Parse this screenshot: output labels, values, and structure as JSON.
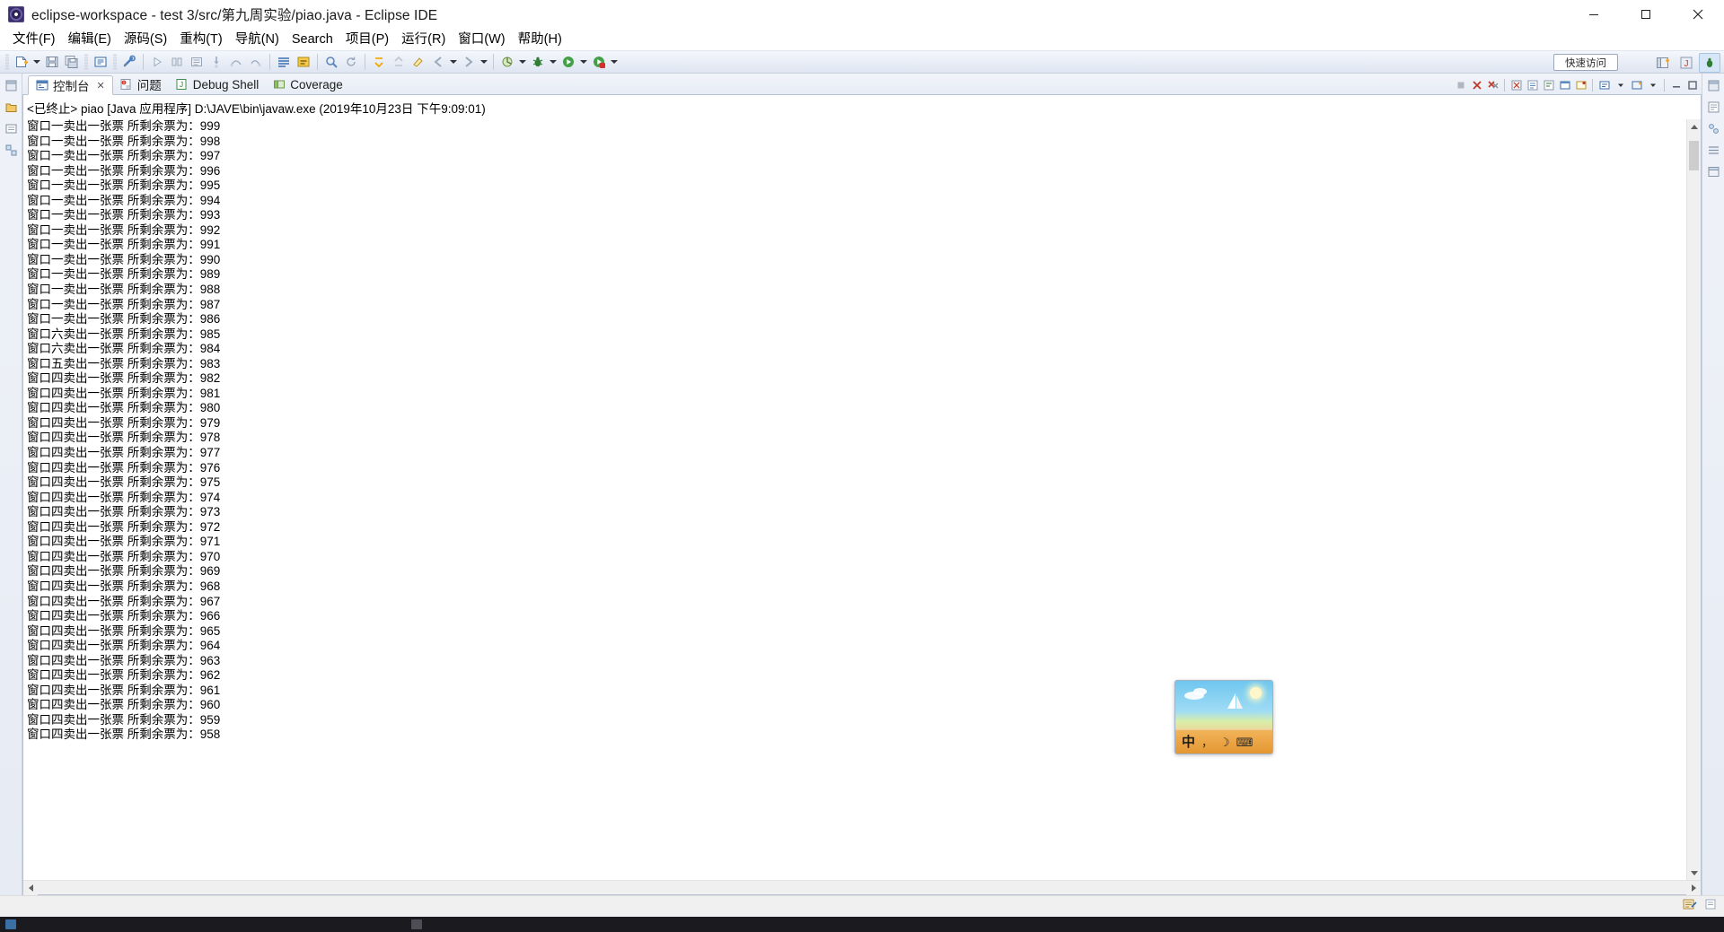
{
  "window": {
    "title": "eclipse-workspace - test 3/src/第九周实验/piao.java - Eclipse IDE",
    "icon": "eclipse-icon",
    "controls": {
      "minimize": "–",
      "maximize": "☐",
      "close": "✕"
    }
  },
  "menubar": {
    "items": [
      {
        "label": "文件(F)",
        "name": "menu-file"
      },
      {
        "label": "编辑(E)",
        "name": "menu-edit"
      },
      {
        "label": "源码(S)",
        "name": "menu-source"
      },
      {
        "label": "重构(T)",
        "name": "menu-refactor"
      },
      {
        "label": "导航(N)",
        "name": "menu-navigate"
      },
      {
        "label": "Search",
        "name": "menu-search"
      },
      {
        "label": "项目(P)",
        "name": "menu-project"
      },
      {
        "label": "运行(R)",
        "name": "menu-run"
      },
      {
        "label": "窗口(W)",
        "name": "menu-window"
      },
      {
        "label": "帮助(H)",
        "name": "menu-help"
      }
    ]
  },
  "toolbar": {
    "quick_access": "快速访问",
    "icons": [
      "new-wizard-icon",
      "save-icon",
      "save-all-icon",
      "print-icon",
      "build-icon",
      "run-last-tool-icon",
      "skip-breakpoints-icon",
      "toggle-breakpoint-icon",
      "step-into-icon",
      "step-over-icon",
      "step-return-icon",
      "open-type-icon",
      "search-icon",
      "history-icon",
      "next-annotation-icon",
      "previous-annotation-icon",
      "last-edit-icon",
      "back-icon",
      "forward-icon",
      "coverage-icon",
      "debug-icon",
      "run-icon",
      "external-tools-icon"
    ],
    "perspective_icons": [
      "open-perspective-icon",
      "java-perspective-icon",
      "debug-perspective-icon"
    ]
  },
  "view_tabs": {
    "items": [
      {
        "label": "控制台",
        "icon": "console-icon",
        "active": true,
        "closable": true
      },
      {
        "label": "问题",
        "icon": "problems-icon",
        "active": false,
        "closable": false
      },
      {
        "label": "Debug Shell",
        "icon": "debug-shell-icon",
        "active": false,
        "closable": false
      },
      {
        "label": "Coverage",
        "icon": "coverage-icon",
        "active": false,
        "closable": false
      }
    ],
    "toolbar_icons": [
      "terminate-icon",
      "remove-launch-icon",
      "remove-all-terminated-icon",
      "clear-console-icon",
      "scroll-lock-icon",
      "word-wrap-icon",
      "show-console-on-output-icon",
      "pin-console-icon",
      "display-selected-console-icon",
      "open-console-icon",
      "view-menu-icon",
      "minimize-icon",
      "maximize-icon"
    ]
  },
  "console": {
    "header": "<已终止> piao [Java 应用程序] D:\\JAVE\\bin\\javaw.exe  (2019年10月23日 下午9:09:01)",
    "lines": [
      "窗口一卖出一张票 所剩余票为：999",
      "窗口一卖出一张票 所剩余票为：998",
      "窗口一卖出一张票 所剩余票为：997",
      "窗口一卖出一张票 所剩余票为：996",
      "窗口一卖出一张票 所剩余票为：995",
      "窗口一卖出一张票 所剩余票为：994",
      "窗口一卖出一张票 所剩余票为：993",
      "窗口一卖出一张票 所剩余票为：992",
      "窗口一卖出一张票 所剩余票为：991",
      "窗口一卖出一张票 所剩余票为：990",
      "窗口一卖出一张票 所剩余票为：989",
      "窗口一卖出一张票 所剩余票为：988",
      "窗口一卖出一张票 所剩余票为：987",
      "窗口一卖出一张票 所剩余票为：986",
      "窗口六卖出一张票 所剩余票为：985",
      "窗口六卖出一张票 所剩余票为：984",
      "窗口五卖出一张票 所剩余票为：983",
      "窗口四卖出一张票 所剩余票为：982",
      "窗口四卖出一张票 所剩余票为：981",
      "窗口四卖出一张票 所剩余票为：980",
      "窗口四卖出一张票 所剩余票为：979",
      "窗口四卖出一张票 所剩余票为：978",
      "窗口四卖出一张票 所剩余票为：977",
      "窗口四卖出一张票 所剩余票为：976",
      "窗口四卖出一张票 所剩余票为：975",
      "窗口四卖出一张票 所剩余票为：974",
      "窗口四卖出一张票 所剩余票为：973",
      "窗口四卖出一张票 所剩余票为：972",
      "窗口四卖出一张票 所剩余票为：971",
      "窗口四卖出一张票 所剩余票为：970",
      "窗口四卖出一张票 所剩余票为：969",
      "窗口四卖出一张票 所剩余票为：968",
      "窗口四卖出一张票 所剩余票为：967",
      "窗口四卖出一张票 所剩余票为：966",
      "窗口四卖出一张票 所剩余票为：965",
      "窗口四卖出一张票 所剩余票为：964",
      "窗口四卖出一张票 所剩余票为：963",
      "窗口四卖出一张票 所剩余票为：962",
      "窗口四卖出一张票 所剩余票为：961",
      "窗口四卖出一张票 所剩余票为：960",
      "窗口四卖出一张票 所剩余票为：959",
      "窗口四卖出一张票 所剩余票为：958"
    ]
  },
  "floating_widget": {
    "name": "ime-language-bar",
    "items": [
      {
        "label": "中",
        "name": "ime-mode-chinese"
      },
      {
        "label": "，",
        "name": "ime-punctuation"
      },
      {
        "label": "☽",
        "name": "ime-moon"
      },
      {
        "label": "⌨",
        "name": "ime-keyboard"
      }
    ]
  },
  "statusbar": {
    "right_icons": [
      "writable-indicator-icon",
      "smart-insert-icon"
    ]
  },
  "taskbar": {
    "time": ""
  },
  "colors": {
    "accent": "#3a6ea5",
    "toolbar_bg": "#e8edf6",
    "console_bg": "#ffffff",
    "title_bg": "#ffffff",
    "text": "#000000"
  }
}
